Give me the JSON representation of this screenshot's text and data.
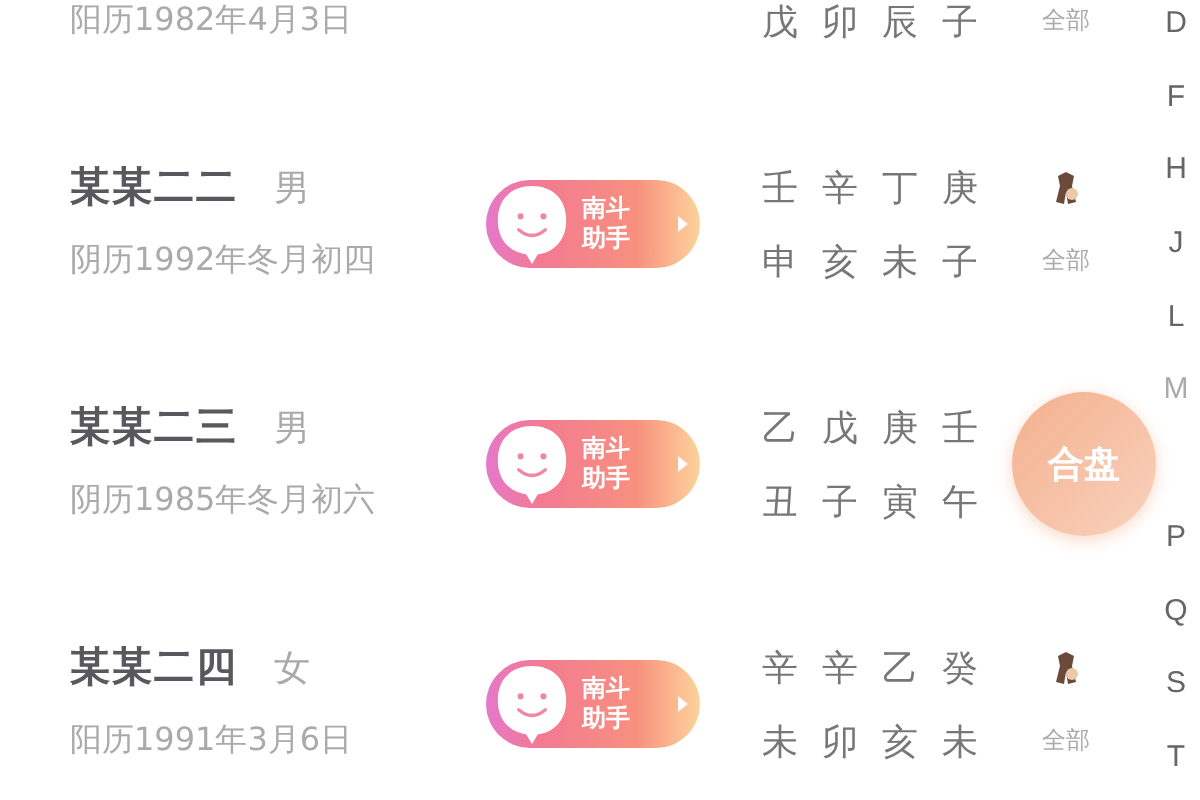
{
  "rows": [
    {
      "kind": "partial",
      "date": "阳历1982年4月3日",
      "branches": [
        "戊",
        "卯",
        "辰",
        "子"
      ],
      "tag": "全部"
    },
    {
      "kind": "full",
      "name": "某某二二",
      "gender": "男",
      "date": "阴历1992年冬月初四",
      "helper": [
        "南斗",
        "助手"
      ],
      "stems": [
        "壬",
        "辛",
        "丁",
        "庚"
      ],
      "branches": [
        "申",
        "亥",
        "未",
        "子"
      ],
      "zodiac": true,
      "tag": "全部"
    },
    {
      "kind": "full",
      "name": "某某二三",
      "gender": "男",
      "date": "阴历1985年冬月初六",
      "helper": [
        "南斗",
        "助手"
      ],
      "stems": [
        "乙",
        "戊",
        "庚",
        "壬"
      ],
      "branches": [
        "丑",
        "子",
        "寅",
        "午"
      ],
      "zodiac": false
    },
    {
      "kind": "full",
      "name": "某某二四",
      "gender": "女",
      "date": "阳历1991年3月6日",
      "helper": [
        "南斗",
        "助手"
      ],
      "stems": [
        "辛",
        "辛",
        "乙",
        "癸"
      ],
      "branches": [
        "未",
        "卯",
        "亥",
        "未"
      ],
      "zodiac": true,
      "tag": "全部"
    }
  ],
  "index": [
    {
      "letter": "D",
      "disabled": false
    },
    {
      "letter": "F",
      "disabled": false
    },
    {
      "letter": "H",
      "disabled": false
    },
    {
      "letter": "J",
      "disabled": false
    },
    {
      "letter": "L",
      "disabled": false
    },
    {
      "letter": "M",
      "disabled": true
    },
    {
      "letter": "P",
      "disabled": false
    },
    {
      "letter": "Q",
      "disabled": false
    },
    {
      "letter": "S",
      "disabled": false
    },
    {
      "letter": "T",
      "disabled": false
    }
  ],
  "fab": {
    "label": "合盘"
  }
}
